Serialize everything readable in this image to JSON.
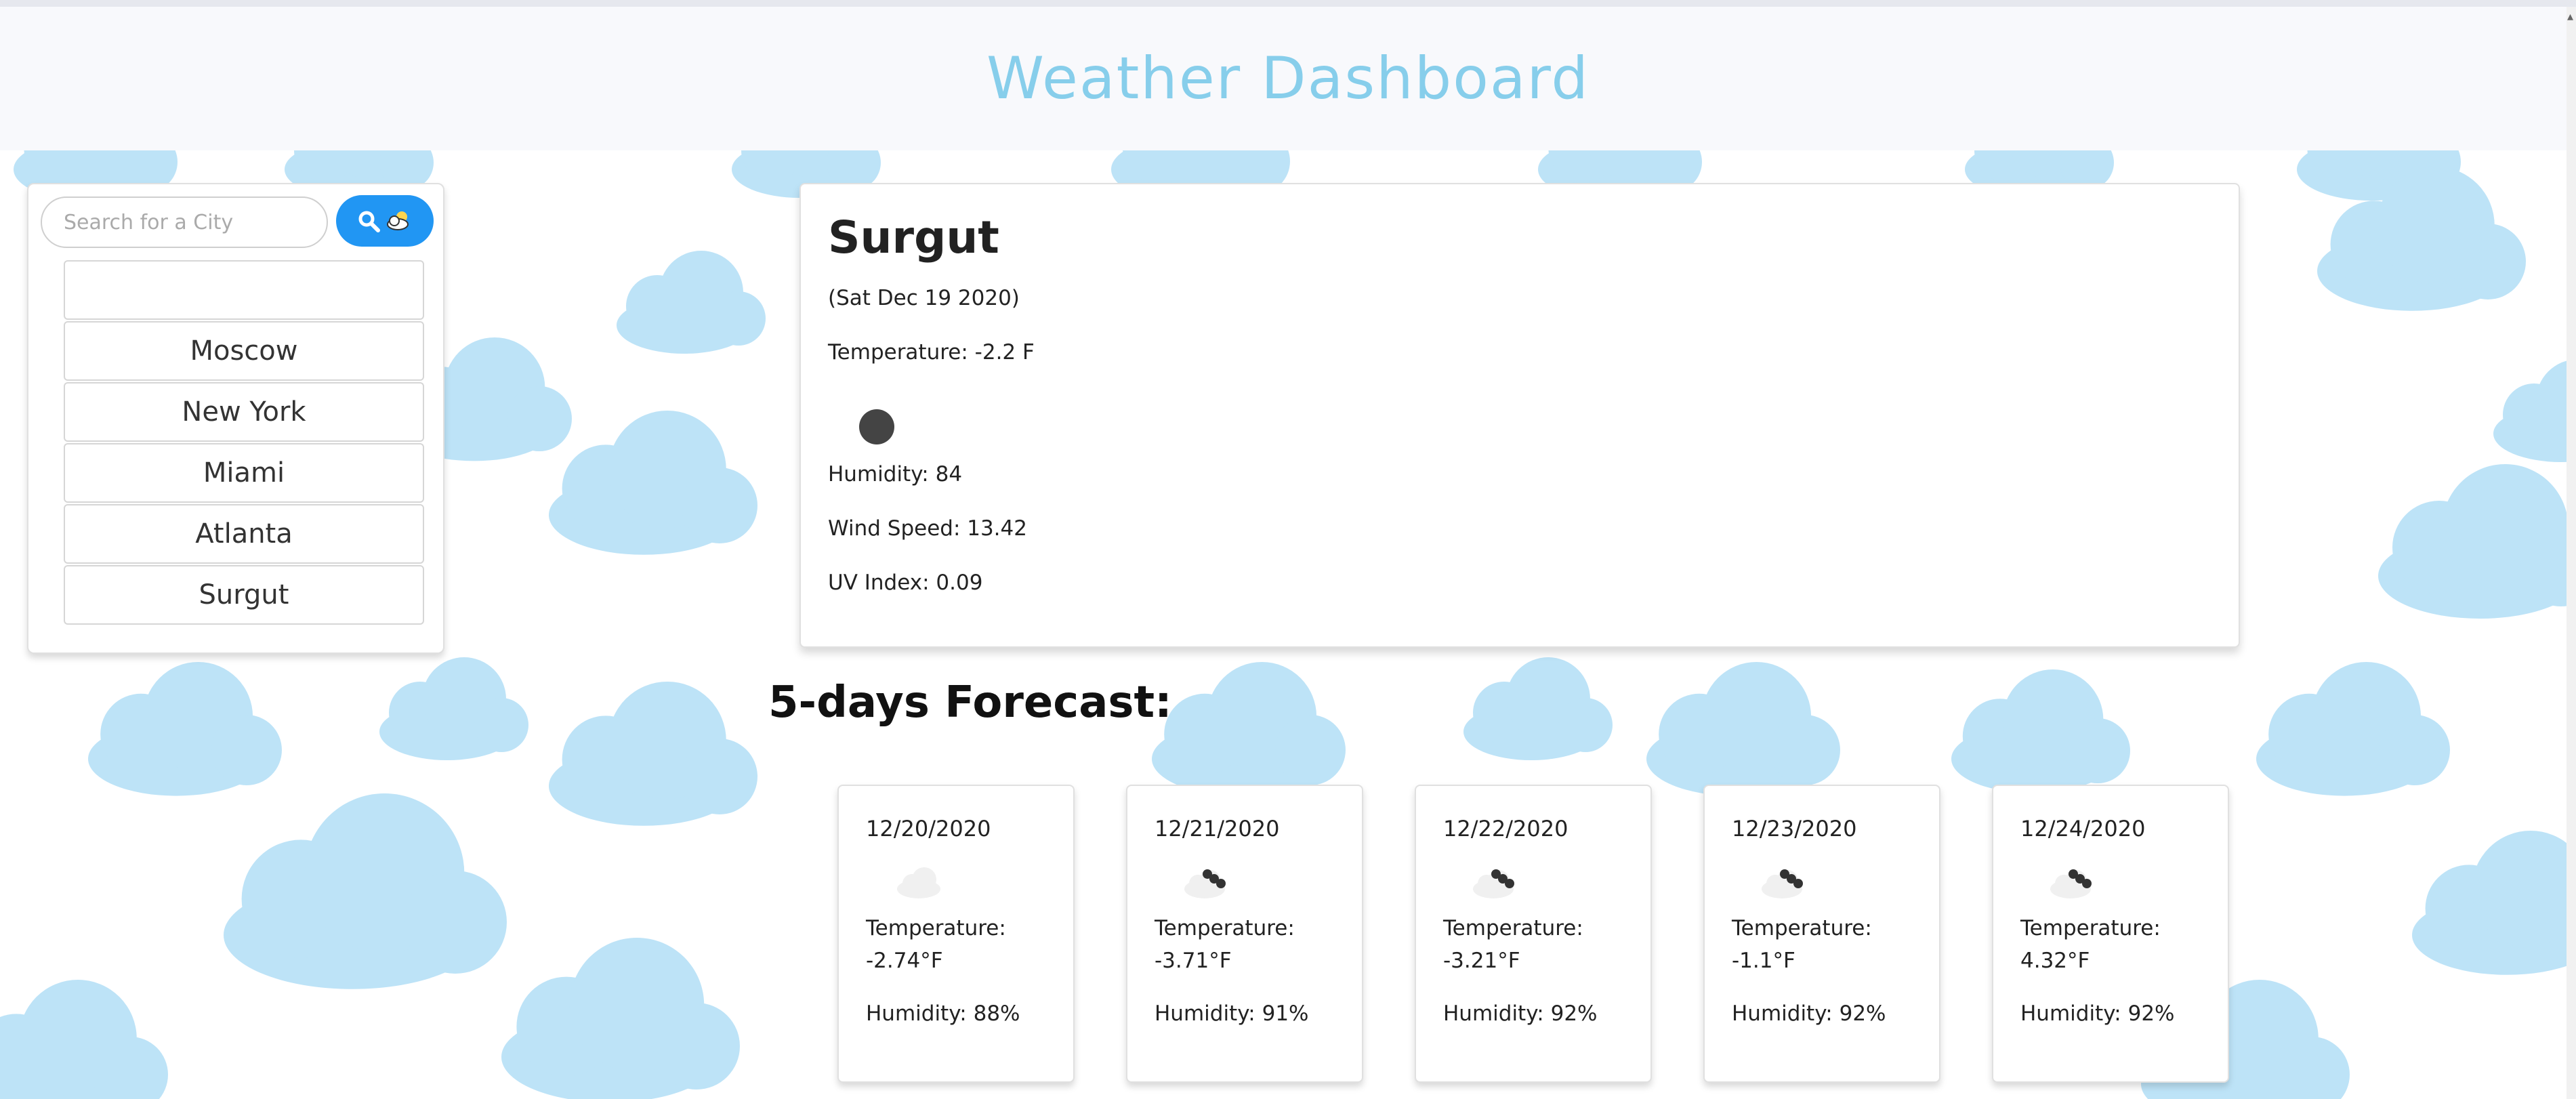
{
  "header": {
    "title": "Weather Dashboard"
  },
  "search": {
    "placeholder": "Search for a City"
  },
  "history": [
    "",
    "Moscow",
    "New York",
    "Miami",
    "Atlanta",
    "Surgut"
  ],
  "current": {
    "city": "Surgut",
    "date": "(Sat Dec 19 2020)",
    "temperature": "Temperature: -2.2 F",
    "humidity": "Humidity: 84",
    "wind": "Wind Speed: 13.42",
    "uv": "UV Index: 0.09"
  },
  "forecast_title": "5-days Forecast:",
  "forecast": [
    {
      "date": "12/20/2020",
      "icon": "cloud-icon",
      "temp_label": "Temperature:",
      "temp": "-2.74°F",
      "humidity": "Humidity: 88%"
    },
    {
      "date": "12/21/2020",
      "icon": "snow-cloud-icon",
      "temp_label": "Temperature:",
      "temp": "-3.71°F",
      "humidity": "Humidity: 91%"
    },
    {
      "date": "12/22/2020",
      "icon": "snow-cloud-icon",
      "temp_label": "Temperature:",
      "temp": "-3.21°F",
      "humidity": "Humidity: 92%"
    },
    {
      "date": "12/23/2020",
      "icon": "snow-cloud-icon",
      "temp_label": "Temperature:",
      "temp": "-1.1°F",
      "humidity": "Humidity: 92%"
    },
    {
      "date": "12/24/2020",
      "icon": "snow-cloud-icon",
      "temp_label": "Temperature:",
      "temp": "4.32°F",
      "humidity": "Humidity: 92%"
    }
  ],
  "colors": {
    "title": "#87ceeb",
    "search_button": "#2196f3",
    "cloud": "#bde3f7"
  }
}
